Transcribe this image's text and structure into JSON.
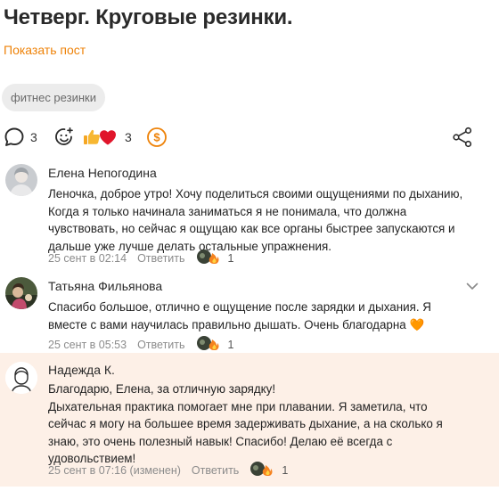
{
  "post": {
    "title": "Четверг. Круговые резинки.",
    "show_post": "Показать пост",
    "tag": "фитнес резинки"
  },
  "actions": {
    "comments_count": "3",
    "reactions_count": "3"
  },
  "comments": [
    {
      "author": "Елена Непогодина",
      "text": "Леночка, доброе утро! Хочу поделиться своими ощущениями по дыханию, Когда я только начинала заниматься я не понимала, что должна чувствовать, но сейчас я ощущаю как все органы быстрее запускаются и дальше уже лучше делать остальные упражнения.",
      "time": "25 сент в 02:14",
      "reply": "Ответить",
      "reactions": "1"
    },
    {
      "author": "Татьяна Фильянова",
      "text": "Спасибо большое, отлично е ощущение после зарядки и дыхания. Я вместе с вами научилась правильно дышать. Очень благодарна",
      "emoji": "🧡",
      "time": "25 сент в 05:53",
      "reply": "Ответить",
      "reactions": "1"
    },
    {
      "author": "Надежда К.",
      "text": "Благодарю, Елена, за отличную зарядку!\nДыхательная практика помогает мне при плавании. Я заметила, что сейчас я могу на большее время задерживать дыхание, а на сколько я знаю, это очень полезный навык! Спасибо! Делаю её всегда с удовольствием!",
      "time": "25 сент в 07:16 (изменен)",
      "reply": "Ответить",
      "reactions": "1"
    }
  ],
  "colors": {
    "accent": "#ee8208",
    "highlight_bg": "#fdf0e7",
    "meta_gray": "#8c8c8c"
  },
  "icons": [
    "comment-icon",
    "smile-plus-icon",
    "thumbs-up-icon",
    "heart-icon",
    "coin-icon",
    "share-icon",
    "chevron-down-icon",
    "fire-icon"
  ]
}
